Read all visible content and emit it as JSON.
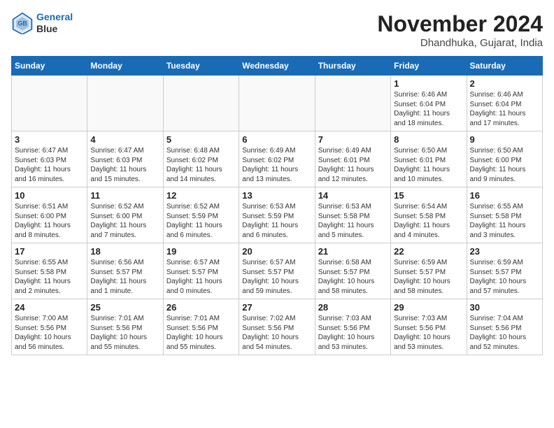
{
  "header": {
    "logo_line1": "General",
    "logo_line2": "Blue",
    "month": "November 2024",
    "location": "Dhandhuka, Gujarat, India"
  },
  "weekdays": [
    "Sunday",
    "Monday",
    "Tuesday",
    "Wednesday",
    "Thursday",
    "Friday",
    "Saturday"
  ],
  "weeks": [
    [
      {
        "day": "",
        "info": ""
      },
      {
        "day": "",
        "info": ""
      },
      {
        "day": "",
        "info": ""
      },
      {
        "day": "",
        "info": ""
      },
      {
        "day": "",
        "info": ""
      },
      {
        "day": "1",
        "info": "Sunrise: 6:46 AM\nSunset: 6:04 PM\nDaylight: 11 hours\nand 18 minutes."
      },
      {
        "day": "2",
        "info": "Sunrise: 6:46 AM\nSunset: 6:04 PM\nDaylight: 11 hours\nand 17 minutes."
      }
    ],
    [
      {
        "day": "3",
        "info": "Sunrise: 6:47 AM\nSunset: 6:03 PM\nDaylight: 11 hours\nand 16 minutes."
      },
      {
        "day": "4",
        "info": "Sunrise: 6:47 AM\nSunset: 6:03 PM\nDaylight: 11 hours\nand 15 minutes."
      },
      {
        "day": "5",
        "info": "Sunrise: 6:48 AM\nSunset: 6:02 PM\nDaylight: 11 hours\nand 14 minutes."
      },
      {
        "day": "6",
        "info": "Sunrise: 6:49 AM\nSunset: 6:02 PM\nDaylight: 11 hours\nand 13 minutes."
      },
      {
        "day": "7",
        "info": "Sunrise: 6:49 AM\nSunset: 6:01 PM\nDaylight: 11 hours\nand 12 minutes."
      },
      {
        "day": "8",
        "info": "Sunrise: 6:50 AM\nSunset: 6:01 PM\nDaylight: 11 hours\nand 10 minutes."
      },
      {
        "day": "9",
        "info": "Sunrise: 6:50 AM\nSunset: 6:00 PM\nDaylight: 11 hours\nand 9 minutes."
      }
    ],
    [
      {
        "day": "10",
        "info": "Sunrise: 6:51 AM\nSunset: 6:00 PM\nDaylight: 11 hours\nand 8 minutes."
      },
      {
        "day": "11",
        "info": "Sunrise: 6:52 AM\nSunset: 6:00 PM\nDaylight: 11 hours\nand 7 minutes."
      },
      {
        "day": "12",
        "info": "Sunrise: 6:52 AM\nSunset: 5:59 PM\nDaylight: 11 hours\nand 6 minutes."
      },
      {
        "day": "13",
        "info": "Sunrise: 6:53 AM\nSunset: 5:59 PM\nDaylight: 11 hours\nand 6 minutes."
      },
      {
        "day": "14",
        "info": "Sunrise: 6:53 AM\nSunset: 5:58 PM\nDaylight: 11 hours\nand 5 minutes."
      },
      {
        "day": "15",
        "info": "Sunrise: 6:54 AM\nSunset: 5:58 PM\nDaylight: 11 hours\nand 4 minutes."
      },
      {
        "day": "16",
        "info": "Sunrise: 6:55 AM\nSunset: 5:58 PM\nDaylight: 11 hours\nand 3 minutes."
      }
    ],
    [
      {
        "day": "17",
        "info": "Sunrise: 6:55 AM\nSunset: 5:58 PM\nDaylight: 11 hours\nand 2 minutes."
      },
      {
        "day": "18",
        "info": "Sunrise: 6:56 AM\nSunset: 5:57 PM\nDaylight: 11 hours\nand 1 minute."
      },
      {
        "day": "19",
        "info": "Sunrise: 6:57 AM\nSunset: 5:57 PM\nDaylight: 11 hours\nand 0 minutes."
      },
      {
        "day": "20",
        "info": "Sunrise: 6:57 AM\nSunset: 5:57 PM\nDaylight: 10 hours\nand 59 minutes."
      },
      {
        "day": "21",
        "info": "Sunrise: 6:58 AM\nSunset: 5:57 PM\nDaylight: 10 hours\nand 58 minutes."
      },
      {
        "day": "22",
        "info": "Sunrise: 6:59 AM\nSunset: 5:57 PM\nDaylight: 10 hours\nand 58 minutes."
      },
      {
        "day": "23",
        "info": "Sunrise: 6:59 AM\nSunset: 5:57 PM\nDaylight: 10 hours\nand 57 minutes."
      }
    ],
    [
      {
        "day": "24",
        "info": "Sunrise: 7:00 AM\nSunset: 5:56 PM\nDaylight: 10 hours\nand 56 minutes."
      },
      {
        "day": "25",
        "info": "Sunrise: 7:01 AM\nSunset: 5:56 PM\nDaylight: 10 hours\nand 55 minutes."
      },
      {
        "day": "26",
        "info": "Sunrise: 7:01 AM\nSunset: 5:56 PM\nDaylight: 10 hours\nand 55 minutes."
      },
      {
        "day": "27",
        "info": "Sunrise: 7:02 AM\nSunset: 5:56 PM\nDaylight: 10 hours\nand 54 minutes."
      },
      {
        "day": "28",
        "info": "Sunrise: 7:03 AM\nSunset: 5:56 PM\nDaylight: 10 hours\nand 53 minutes."
      },
      {
        "day": "29",
        "info": "Sunrise: 7:03 AM\nSunset: 5:56 PM\nDaylight: 10 hours\nand 53 minutes."
      },
      {
        "day": "30",
        "info": "Sunrise: 7:04 AM\nSunset: 5:56 PM\nDaylight: 10 hours\nand 52 minutes."
      }
    ]
  ]
}
